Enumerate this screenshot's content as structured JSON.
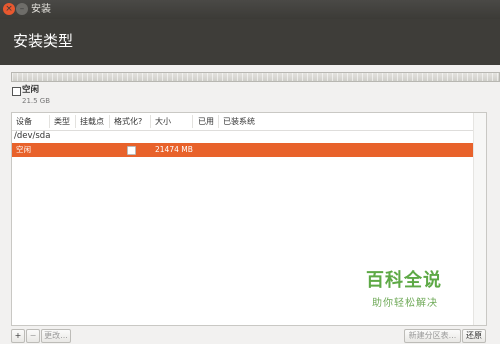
{
  "window": {
    "title": "安装",
    "close_glyph": "×",
    "min_glyph": "–"
  },
  "header": {
    "title": "安装类型"
  },
  "legend": {
    "label": "空闲",
    "size": "21.5 GB"
  },
  "table": {
    "columns": [
      "设备",
      "类型",
      "挂载点",
      "格式化?",
      "大小",
      "已用",
      "已装系统"
    ],
    "device": "/dev/sda",
    "rows": [
      {
        "device": "空闲",
        "type": "",
        "mount": "",
        "format": false,
        "size": "21474 MB",
        "used": "",
        "os": ""
      }
    ]
  },
  "toolbar": {
    "add": "+",
    "remove": "−",
    "change": "更改...",
    "new_table": "新建分区表...",
    "revert": "还原"
  },
  "watermark": {
    "main": "百科全说",
    "sub": "助你轻松解决"
  },
  "colors": {
    "accent": "#e8622b",
    "header_bg": "#3e3d39"
  }
}
